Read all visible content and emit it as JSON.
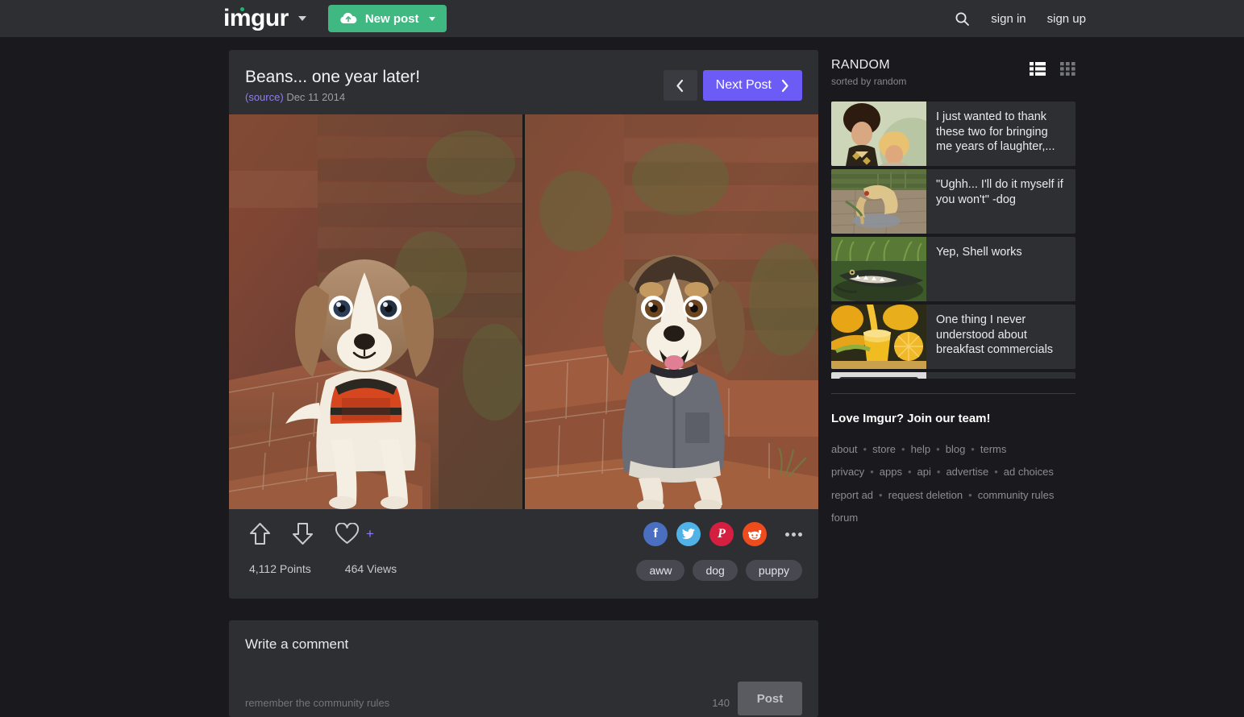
{
  "nav": {
    "logo": "imgur",
    "logo_chevron_icon": "chevron-down-icon",
    "new_post_label": "New post",
    "new_post_icon": "cloud-upload-icon",
    "new_post_chevron_icon": "chevron-down-icon",
    "search_icon": "search-icon",
    "sign_in": "sign in",
    "sign_up": "sign up",
    "accent_green": "#3fb981"
  },
  "post": {
    "title": "Beans... one year later!",
    "source_label": "(source)",
    "date": "Dec 11 2014",
    "prev_icon": "chevron-left-icon",
    "next_label": "Next Post",
    "next_icon": "chevron-right-icon",
    "next_color": "#6c5cf5",
    "image_alt": "Side-by-side photos of a beagle mix puppy in a red harness and the same dog one year later in a grey coat, sitting on red brick steps",
    "upvote_icon": "arrow-up-icon",
    "downvote_icon": "arrow-down-icon",
    "favorite_icon": "heart-icon",
    "favorite_plus": "+",
    "points": "4,112 Points",
    "views": "464 Views",
    "share": [
      {
        "name": "facebook",
        "glyph": "f",
        "color": "#4a6fc0"
      },
      {
        "name": "twitter",
        "glyph": "t",
        "color": "#4fb3e8"
      },
      {
        "name": "pinterest",
        "glyph": "P",
        "color": "#d51f40"
      },
      {
        "name": "reddit",
        "glyph": "r",
        "color": "#f04b1d"
      }
    ],
    "more_icon": "ellipsis-icon",
    "tags": [
      "aww",
      "dog",
      "puppy"
    ]
  },
  "comment": {
    "heading": "Write a comment",
    "placeholder": "remember the community rules",
    "value": "",
    "char_count": "140",
    "post_label": "Post"
  },
  "sidebar": {
    "title": "RANDOM",
    "subtitle": "sorted by random",
    "list_view_icon": "list-view-icon",
    "grid_view_icon": "grid-view-icon",
    "items": [
      {
        "text": "I just wanted to thank these two for bringing me years of laughter,...",
        "thumb": "two-men-portrait"
      },
      {
        "text": "\"Ughh... I'll do it myself if you won't\" -dog",
        "thumb": "dog-drinking-puddle"
      },
      {
        "text": "Yep, Shell works",
        "thumb": "alligator-in-grass"
      },
      {
        "text": "One thing I never understood about breakfast commercials",
        "thumb": "orange-juice-pour"
      },
      {
        "text": "",
        "thumb": "partial-item"
      }
    ],
    "join_text": "Love Imgur? Join our team!",
    "footer_rows": [
      [
        "about",
        "store",
        "help",
        "blog",
        "terms"
      ],
      [
        "privacy",
        "apps",
        "api",
        "advertise",
        "ad choices"
      ],
      [
        "report ad",
        "request deletion",
        "community rules"
      ],
      [
        "forum"
      ]
    ]
  }
}
